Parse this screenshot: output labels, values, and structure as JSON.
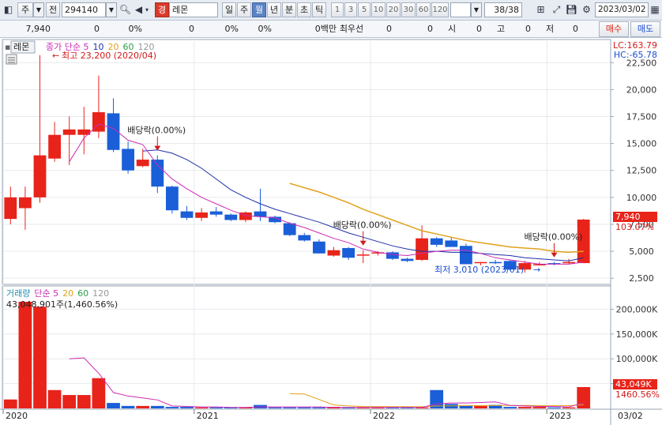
{
  "toolbar": {
    "market_label": "주",
    "market_caret": "▼",
    "prefix_label": "전",
    "code": "294140",
    "code_caret": "▼",
    "search_icon": "search-icon",
    "sound_icon": "speaker-icon",
    "group_badge": "경",
    "name": "레몬",
    "period_tabs": [
      "일",
      "주",
      "월",
      "년",
      "분",
      "초",
      "틱"
    ],
    "active_period": "월",
    "interval_numbers": [
      "1",
      "3",
      "5",
      "10",
      "20",
      "30",
      "60",
      "120"
    ],
    "count_display": "38/38",
    "tool_icons": [
      "grid-plus-icon",
      "crosshair-icon",
      "save-icon",
      "gear-icon"
    ],
    "date": "2023/03/02",
    "calendar_icon": "calendar-icon"
  },
  "quote": {
    "price": "7,940",
    "change": "0",
    "change_pct1": "0%",
    "volume": "0",
    "change_pct2": "0%",
    "amount": "0백만",
    "ask_label": "최우선",
    "ask1": "0",
    "ask2": "0",
    "open_label": "시",
    "open": "0",
    "high_label": "고",
    "high": "0",
    "low_label": "저",
    "low": "0",
    "buy_label": "매수",
    "sell_label": "매도"
  },
  "price_panel": {
    "symbol_tab": "레몬",
    "legend": [
      {
        "text": "종가 단순 5",
        "color": "#cc2bb5"
      },
      {
        "text": "10",
        "color": "#1f2fa8"
      },
      {
        "text": "20",
        "color": "#e0a21b"
      },
      {
        "text": "60",
        "color": "#2aa04a"
      },
      {
        "text": "120",
        "color": "#999999"
      }
    ],
    "lc_label": "LC:163.79",
    "hc_label": "HC:-65.78",
    "high_annotation": "최고 23,200 (2020/04)",
    "low_annotation": "최저 3,010 (2023/01)",
    "dividend_label": "배당락(0.00%)",
    "last_price_tag": "7,940",
    "last_pct_tag": "103.07%",
    "y_ticks": [
      "22,500",
      "20,000",
      "17,500",
      "15,000",
      "12,500",
      "10,000",
      "7,500",
      "5,000",
      "2,500"
    ]
  },
  "volume_panel": {
    "legend": [
      {
        "text": "거래량",
        "color": "#1f8fb0"
      },
      {
        "text": "단순 5",
        "color": "#cc2bb5"
      },
      {
        "text": "20",
        "color": "#e0a21b"
      },
      {
        "text": "60",
        "color": "#2aa04a"
      },
      {
        "text": "120",
        "color": "#999999"
      }
    ],
    "max_annotation": "43,048,901주(1,460.56%)",
    "last_vol_tag": "43,049K",
    "last_vol_pct_tag": "1460.56%",
    "y_ticks": [
      "200,000K",
      "150,000K",
      "100,000K",
      "50,000K"
    ]
  },
  "x_axis": {
    "labels": [
      "2020",
      "2021",
      "2022",
      "2023"
    ],
    "last_label": "03/02"
  },
  "colors": {
    "up": "#e8231a",
    "down": "#1a5fd8",
    "ma5": "#cc2bb5",
    "ma10": "#1f2fa8",
    "ma20": "#e0a21b"
  },
  "chart_data": {
    "type": "candlestick",
    "period": "monthly",
    "months": [
      "2019/12",
      "2020/01",
      "2020/02",
      "2020/03",
      "2020/04",
      "2020/05",
      "2020/06",
      "2020/07",
      "2020/08",
      "2020/09",
      "2020/10",
      "2020/11",
      "2020/12",
      "2021/01",
      "2021/02",
      "2021/03",
      "2021/04",
      "2021/05",
      "2021/06",
      "2021/07",
      "2021/08",
      "2021/09",
      "2021/10",
      "2021/11",
      "2021/12",
      "2022/01",
      "2022/02",
      "2022/03",
      "2022/04",
      "2022/05",
      "2022/06",
      "2022/07",
      "2022/08",
      "2022/09",
      "2022/10",
      "2022/11",
      "2022/12",
      "2023/01",
      "2023/02",
      "2023/03"
    ],
    "candles": [
      {
        "o": 8000,
        "h": 11000,
        "l": 7500,
        "c": 10000
      },
      {
        "o": 9000,
        "h": 11000,
        "l": 7000,
        "c": 10000
      },
      {
        "o": 10000,
        "h": 23200,
        "l": 9500,
        "c": 13900
      },
      {
        "o": 13600,
        "h": 17000,
        "l": 13300,
        "c": 15800
      },
      {
        "o": 15800,
        "h": 17500,
        "l": 13000,
        "c": 16300
      },
      {
        "o": 15800,
        "h": 18400,
        "l": 14000,
        "c": 16300
      },
      {
        "o": 16100,
        "h": 21300,
        "l": 15500,
        "c": 17900
      },
      {
        "o": 17800,
        "h": 19200,
        "l": 14200,
        "c": 14400
      },
      {
        "o": 14500,
        "h": 15200,
        "l": 12200,
        "c": 12500
      },
      {
        "o": 12900,
        "h": 14500,
        "l": 12800,
        "c": 13500
      },
      {
        "o": 13500,
        "h": 13900,
        "l": 10400,
        "c": 11000
      },
      {
        "o": 11000,
        "h": 11100,
        "l": 8500,
        "c": 8800
      },
      {
        "o": 8700,
        "h": 9200,
        "l": 7900,
        "c": 8100
      },
      {
        "o": 8100,
        "h": 9000,
        "l": 7800,
        "c": 8600
      },
      {
        "o": 8700,
        "h": 9100,
        "l": 8200,
        "c": 8400
      },
      {
        "o": 8400,
        "h": 8500,
        "l": 7800,
        "c": 7900
      },
      {
        "o": 7900,
        "h": 8700,
        "l": 7700,
        "c": 8600
      },
      {
        "o": 8700,
        "h": 10800,
        "l": 7800,
        "c": 8200
      },
      {
        "o": 8200,
        "h": 8300,
        "l": 7600,
        "c": 7700
      },
      {
        "o": 7600,
        "h": 7700,
        "l": 6400,
        "c": 6500
      },
      {
        "o": 6500,
        "h": 6700,
        "l": 5900,
        "c": 6000
      },
      {
        "o": 5900,
        "h": 6100,
        "l": 4800,
        "c": 4800
      },
      {
        "o": 4600,
        "h": 5400,
        "l": 4500,
        "c": 5100
      },
      {
        "o": 5300,
        "h": 5400,
        "l": 4200,
        "c": 4400
      },
      {
        "o": 4600,
        "h": 5100,
        "l": 3900,
        "c": 4700
      },
      {
        "o": 4800,
        "h": 5000,
        "l": 4600,
        "c": 4900
      },
      {
        "o": 4900,
        "h": 5000,
        "l": 4200,
        "c": 4300
      },
      {
        "o": 4300,
        "h": 4400,
        "l": 4000,
        "c": 4100
      },
      {
        "o": 4200,
        "h": 7400,
        "l": 4100,
        "c": 6200
      },
      {
        "o": 6200,
        "h": 6300,
        "l": 5400,
        "c": 5600
      },
      {
        "o": 6000,
        "h": 6300,
        "l": 5500,
        "c": 5400
      },
      {
        "o": 5500,
        "h": 5700,
        "l": 3800,
        "c": 3800
      },
      {
        "o": 3900,
        "h": 4000,
        "l": 3700,
        "c": 4000
      },
      {
        "o": 4000,
        "h": 4200,
        "l": 3800,
        "c": 3900
      },
      {
        "o": 4100,
        "h": 4200,
        "l": 3200,
        "c": 3300
      },
      {
        "o": 3300,
        "h": 4100,
        "l": 3010,
        "c": 3900
      },
      {
        "o": 3800,
        "h": 4000,
        "l": 3700,
        "c": 3800
      },
      {
        "o": 3900,
        "h": 4000,
        "l": 3700,
        "c": 3800
      },
      {
        "o": 3900,
        "h": 4300,
        "l": 3800,
        "c": 4000
      },
      {
        "o": 3900,
        "h": 8000,
        "l": 3900,
        "c": 7940
      }
    ],
    "volume_k": [
      18000,
      215000,
      205000,
      37000,
      27000,
      27000,
      61000,
      11000,
      5000,
      5000,
      5000,
      3000,
      3000,
      2000,
      2000,
      2000,
      2000,
      7000,
      2000,
      2000,
      2000,
      2000,
      3000,
      2000,
      2000,
      2000,
      2000,
      2000,
      2000,
      37000,
      9000,
      6000,
      5000,
      7000,
      3000,
      3000,
      3000,
      2000,
      2000,
      43049
    ],
    "ma5": [
      null,
      null,
      null,
      null,
      13300,
      15500,
      16800,
      16400,
      15300,
      14900,
      13000,
      11700,
      10800,
      10000,
      9400,
      8800,
      8300,
      8200,
      8100,
      7600,
      7200,
      6700,
      6200,
      5800,
      5200,
      4900,
      4700,
      4600,
      4800,
      5000,
      5100,
      5100,
      4800,
      4400,
      4200,
      4000,
      3800,
      3800,
      3800,
      4000
    ],
    "ma10": [
      null,
      null,
      null,
      null,
      null,
      null,
      null,
      null,
      null,
      14300,
      14400,
      14100,
      13500,
      12700,
      11700,
      10700,
      10000,
      9400,
      8900,
      8500,
      8100,
      7700,
      7200,
      6700,
      6300,
      5900,
      5500,
      5200,
      5000,
      5000,
      4900,
      4900,
      4800,
      4700,
      4600,
      4400,
      4300,
      4200,
      4100,
      4400
    ],
    "ma20": [
      null,
      null,
      null,
      null,
      null,
      null,
      null,
      null,
      null,
      null,
      null,
      null,
      null,
      null,
      null,
      null,
      null,
      null,
      null,
      11300,
      10900,
      10500,
      10000,
      9500,
      8900,
      8400,
      7900,
      7400,
      6900,
      6600,
      6300,
      6000,
      5800,
      5600,
      5400,
      5300,
      5200,
      5000,
      4900,
      5000
    ],
    "vol_ma5": [
      null,
      null,
      null,
      null,
      100000,
      102000,
      71000,
      32000,
      25000,
      21000,
      17000,
      5000,
      4000,
      3000,
      3000,
      2000,
      2000,
      3000,
      3000,
      3000,
      3000,
      3000,
      2000,
      2000,
      2000,
      2000,
      2000,
      2000,
      2000,
      9000,
      11000,
      11000,
      12000,
      13000,
      6000,
      5000,
      4000,
      4000,
      3000,
      11000
    ],
    "vol_ma20": [
      null,
      null,
      null,
      null,
      null,
      null,
      null,
      null,
      null,
      null,
      null,
      null,
      null,
      null,
      null,
      null,
      null,
      null,
      null,
      30000,
      29000,
      18000,
      7000,
      5000,
      4000,
      3800,
      3600,
      3500,
      3400,
      5000,
      5300,
      5500,
      5700,
      6000,
      6000,
      5900,
      5800,
      5700,
      5600,
      7500
    ],
    "dividend_markers": [
      {
        "month": "2020/10",
        "label": "배당락(0.00%)"
      },
      {
        "month": "2021/12",
        "label": "배당락(0.00%)"
      },
      {
        "month": "2023/01",
        "label": "배당락(0.00%)"
      }
    ],
    "price_ylim": [
      2000,
      24500
    ],
    "volume_ylim": [
      0,
      215000
    ],
    "y_ticks_price": [
      2500,
      5000,
      7500,
      10000,
      12500,
      15000,
      17500,
      20000,
      22500
    ],
    "y_ticks_volume": [
      50000,
      100000,
      150000,
      200000
    ]
  }
}
